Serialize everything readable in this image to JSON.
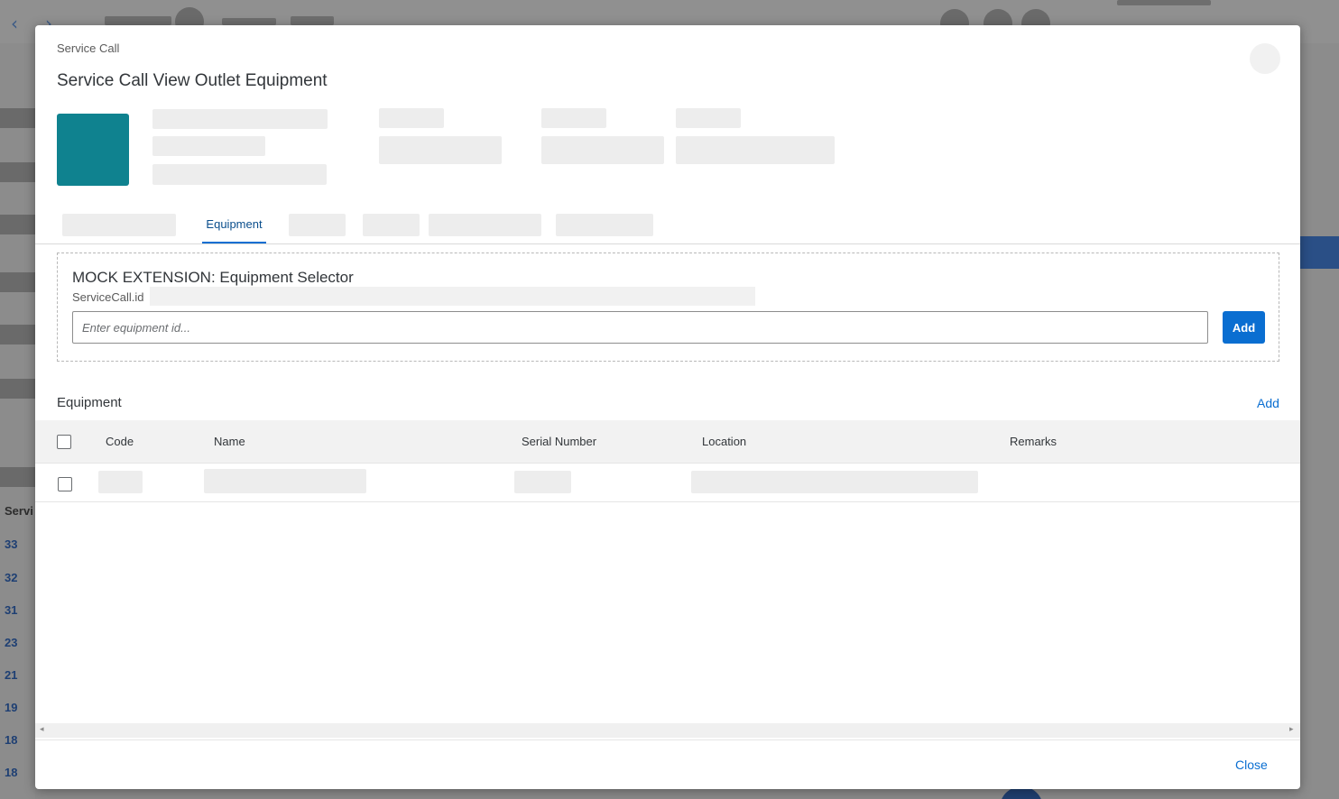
{
  "background": {
    "nav_back": "‹",
    "nav_forward": "›",
    "list_header": "Servi",
    "list_numbers": [
      "33",
      "32",
      "31",
      "23",
      "21",
      "19",
      "18",
      "18"
    ]
  },
  "dialog": {
    "subtitle": "Service Call",
    "title": "Service Call View Outlet Equipment",
    "accent_color": "#0f828f",
    "tabs": {
      "active_label": "Equipment"
    },
    "extension": {
      "title": "MOCK EXTENSION: Equipment Selector",
      "id_label": "ServiceCall.id",
      "input_placeholder": "Enter equipment id...",
      "add_label": "Add"
    },
    "equipment_section": {
      "title": "Equipment",
      "add_label": "Add",
      "columns": [
        "Code",
        "Name",
        "Serial Number",
        "Location",
        "Remarks"
      ]
    },
    "footer": {
      "close_label": "Close"
    }
  }
}
